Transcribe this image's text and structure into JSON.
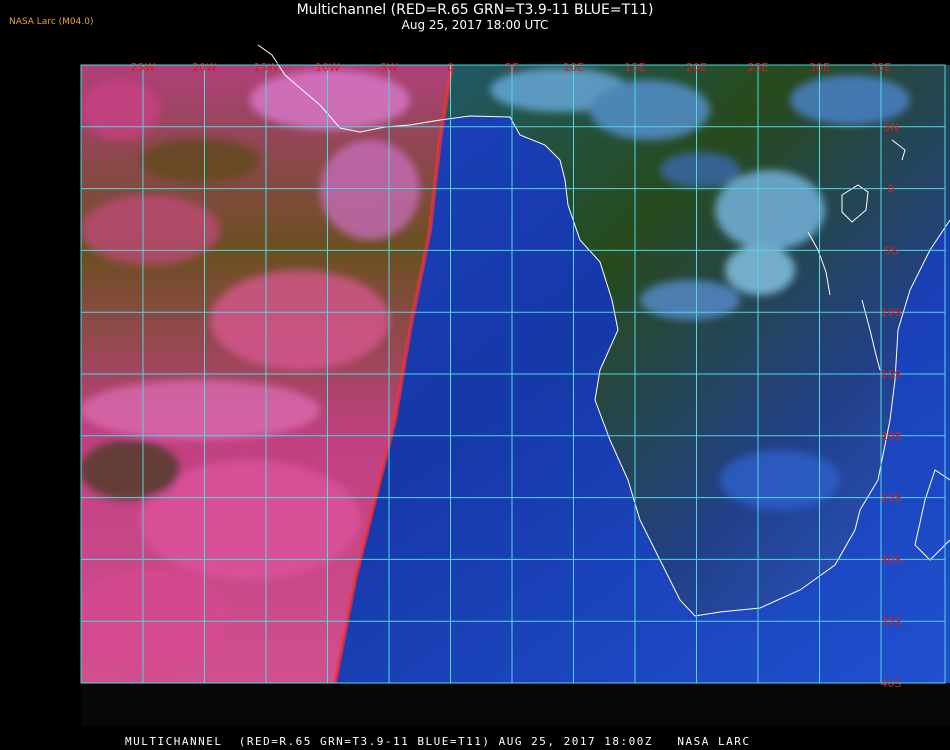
{
  "header": {
    "source_logo": "NASA Larc (M04.0)",
    "title": "Multichannel (RED=R.65 GRN=T3.9-11 BLUE=T11)",
    "datetime": "Aug 25, 2017 18:00 UTC"
  },
  "footer": {
    "caption": "MULTICHANNEL  (RED=R.65 GRN=T3.9-11 BLUE=T11) AUG 25, 2017 18:00Z   NASA LARC"
  },
  "map": {
    "longitude_labels": [
      "25W",
      "20W",
      "15W",
      "10W",
      "5W",
      "0",
      "5E",
      "10E",
      "15E",
      "20E",
      "25E",
      "30E",
      "35E"
    ],
    "latitude_labels": [
      "5N",
      "0",
      "5S",
      "10S",
      "15S",
      "20S",
      "25S",
      "30S",
      "35S",
      "40S"
    ],
    "colors": {
      "grid": "#4fd8e0",
      "label": "#d02020",
      "coast": "#ffffff",
      "ocean_blue": "#1a3fb8",
      "land_green": "#2d4a18",
      "cloud_pink": "#e0509a",
      "cloud_cyan": "#8fd0f0"
    }
  }
}
